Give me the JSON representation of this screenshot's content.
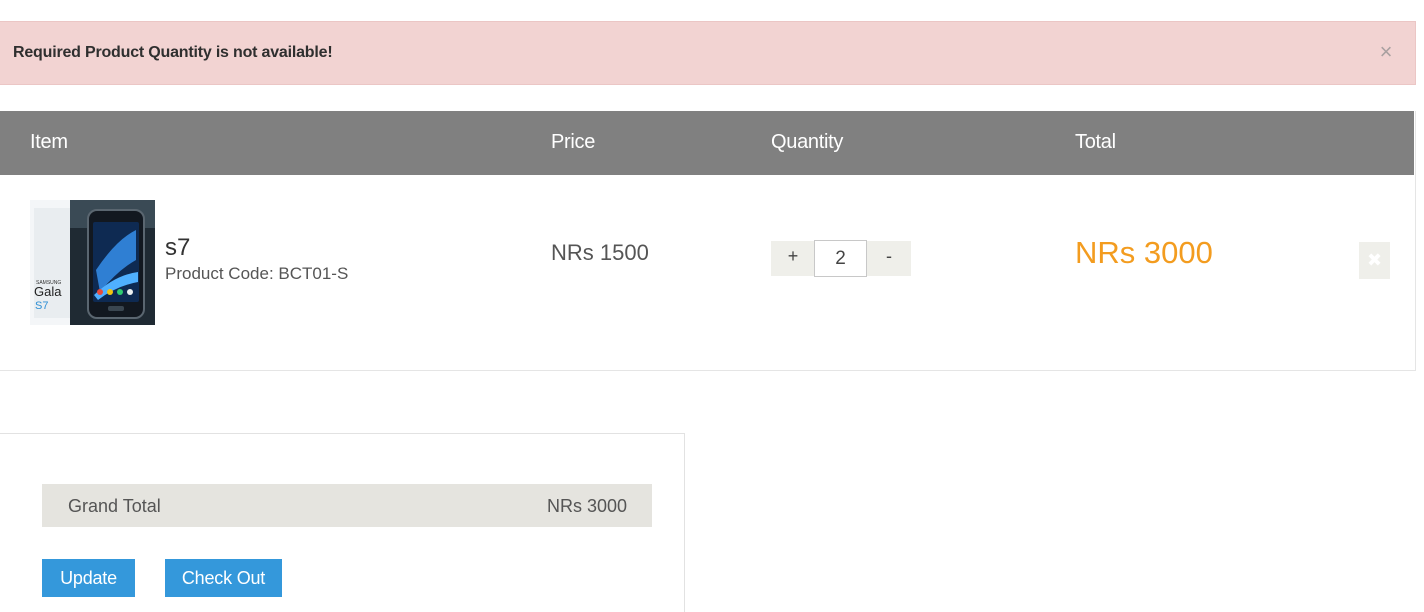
{
  "alert": {
    "message": "Required Product Quantity is not available!",
    "close_glyph": "×"
  },
  "cart": {
    "headers": {
      "item": "Item",
      "price": "Price",
      "quantity": "Quantity",
      "total": "Total"
    },
    "items": [
      {
        "image": "product-thumbnail-samsung-galaxy-s7",
        "name": "s7",
        "code_label": "Product Code: BCT01-S",
        "price": "NRs 1500",
        "quantity": "2",
        "plus_label": "+",
        "minus_label": "-",
        "total": "NRs 3000",
        "remove_glyph": "✖"
      }
    ]
  },
  "summary": {
    "grand_total_label": "Grand Total",
    "grand_total_value": "NRs 3000",
    "update_label": "Update",
    "checkout_label": "Check Out"
  },
  "colors": {
    "alert_bg": "#f2d3d2",
    "header_bg": "#808080",
    "total_accent": "#f39c1f",
    "button_primary": "#3498db"
  }
}
